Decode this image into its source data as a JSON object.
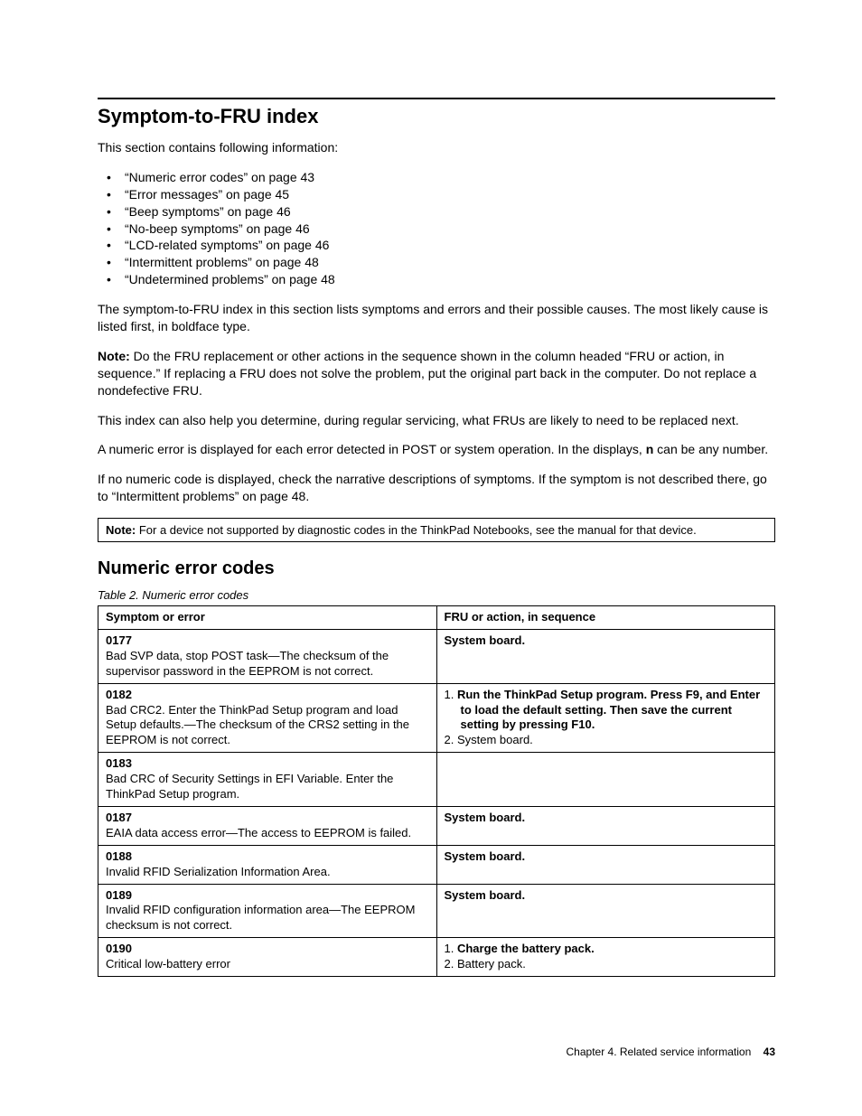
{
  "heading1": "Symptom-to-FRU index",
  "intro": "This section contains following information:",
  "toc": [
    "“Numeric error codes” on page 43",
    "“Error messages” on page 45",
    "“Beep symptoms” on page 46",
    "“No-beep symptoms” on page 46",
    "“LCD-related symptoms” on page 46",
    "“Intermittent problems” on page 48",
    "“Undetermined problems” on page 48"
  ],
  "para1": "The symptom-to-FRU index in this section lists symptoms and errors and their possible causes. The most likely cause is listed first, in boldface type.",
  "note_label": "Note:",
  "para_note": " Do the FRU replacement or other actions in the sequence shown in the column headed “FRU or action, in sequence.” If replacing a FRU does not solve the problem, put the original part back in the computer. Do not replace a nondefective FRU.",
  "para2": "This index can also help you determine, during regular servicing, what FRUs are likely to need to be replaced next.",
  "para3a": "A numeric error is displayed for each error detected in POST or system operation. In the displays, ",
  "para3b": "n",
  "para3c": " can be any number.",
  "para4": "If no numeric code is displayed, check the narrative descriptions of symptoms. If the symptom is not described there, go to “Intermittent problems” on page 48.",
  "boxnote_label": "Note:",
  "boxnote": " For a device not supported by diagnostic codes in the ThinkPad Notebooks, see the manual for that device.",
  "heading2": "Numeric error codes",
  "tablecaption": "Table 2.  Numeric error codes",
  "th1": "Symptom or error",
  "th2": "FRU or action, in sequence",
  "rows": [
    {
      "code": "0177",
      "symptom": "Bad SVP data, stop POST task—The checksum of the supervisor password in the EEPROM is not correct.",
      "actions": [
        {
          "text": "System board.",
          "bold": true
        }
      ],
      "numbered": false
    },
    {
      "code": "0182",
      "symptom": "Bad CRC2. Enter the ThinkPad Setup program and load Setup defaults.—The checksum of the CRS2 setting in the EEPROM is not correct.",
      "actions": [
        {
          "text": "Run the ThinkPad Setup program. Press F9, and Enter to load the default setting. Then save the current setting by pressing F10.",
          "bold": true
        },
        {
          "text": "System board.",
          "bold": false
        }
      ],
      "numbered": true
    },
    {
      "code": "0183",
      "symptom": "Bad CRC of Security Settings in EFI Variable. Enter the ThinkPad Setup program.",
      "actions": [],
      "numbered": false
    },
    {
      "code": "0187",
      "symptom": "EAIA data access error—The access to EEPROM is failed.",
      "actions": [
        {
          "text": "System board.",
          "bold": true
        }
      ],
      "numbered": false
    },
    {
      "code": "0188",
      "symptom": "Invalid RFID Serialization Information Area.",
      "actions": [
        {
          "text": "System board.",
          "bold": true
        }
      ],
      "numbered": false
    },
    {
      "code": "0189",
      "symptom": "Invalid RFID configuration information area—The EEPROM checksum is not correct.",
      "actions": [
        {
          "text": "System board.",
          "bold": true
        }
      ],
      "numbered": false
    },
    {
      "code": "0190",
      "symptom": "Critical low-battery error",
      "actions": [
        {
          "text": "Charge the battery pack.",
          "bold": true
        },
        {
          "text": "Battery pack.",
          "bold": false
        }
      ],
      "numbered": true
    }
  ],
  "footer_chapter": "Chapter 4. Related service information",
  "footer_page": "43"
}
